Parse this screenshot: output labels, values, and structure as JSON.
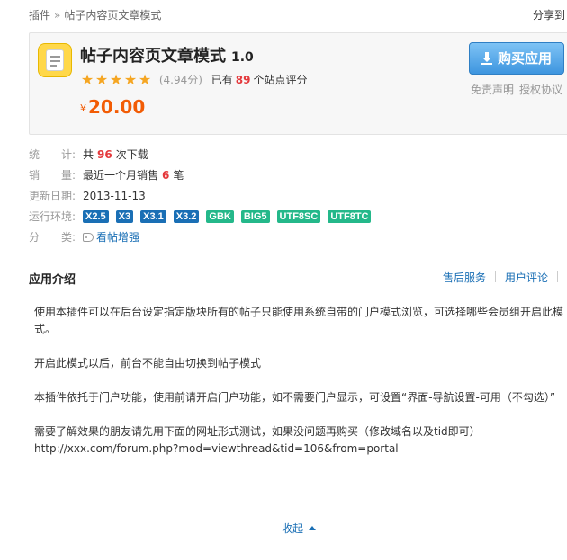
{
  "breadcrumb": {
    "root": "插件",
    "separator": "»",
    "current": "帖子内容页文章模式"
  },
  "share_label": "分享到",
  "plugin": {
    "title": "帖子内容页文章模式",
    "version": "1.0",
    "rating_score": "(4.94分)",
    "rating_stars": 5,
    "rating_prefix": "已有",
    "rating_count": "89",
    "rating_suffix": "个站点评分",
    "currency": "¥",
    "price": "20.00",
    "logo_icon": "document-icon"
  },
  "actions": {
    "buy_label": "购买应用",
    "disclaimer": "免责声明",
    "license": "授权协议"
  },
  "info": {
    "stats_label": "统　　计:",
    "stats_prefix": "共",
    "stats_value": "96",
    "stats_suffix": "次下载",
    "sales_label": "销　　量:",
    "sales_prefix": "最近一个月销售",
    "sales_value": "6",
    "sales_suffix": "笔",
    "updated_label": "更新日期:",
    "updated_value": "2013-11-13",
    "env_label": "运行环境:",
    "env_tags": [
      "X2.5",
      "X3",
      "X3.1",
      "X3.2",
      "GBK",
      "BIG5",
      "UTF8SC",
      "UTF8TC"
    ],
    "category_label": "分　　类:",
    "category_value": "看帖增强"
  },
  "section": {
    "title": "应用介绍",
    "tab_service": "售后服务",
    "tab_reviews": "用户评论"
  },
  "description": {
    "p1": "使用本插件可以在后台设定指定版块所有的帖子只能使用系统自带的门户模式浏览，可选择哪些会员组开启此模式。",
    "p2": "开启此模式以后，前台不能自由切换到帖子模式",
    "p3": "本插件依托于门户功能，使用前请开启门户功能，如不需要门户显示，可设置“界面-导航设置-可用（不勾选）”",
    "p4": "需要了解效果的朋友请先用下面的网址形式测试，如果没问题再购买（修改域名以及tid即可）",
    "url": "http://xxx.com/forum.php?mod=viewthread&tid=106&from=portal"
  },
  "collapse_label": "收起",
  "colors": {
    "accent": "#1a6fb5",
    "price": "#f25c05",
    "highlight": "#e4393c",
    "star": "#f5a623",
    "env_blue": "#1a6fb5",
    "env_green": "#24b88a"
  }
}
